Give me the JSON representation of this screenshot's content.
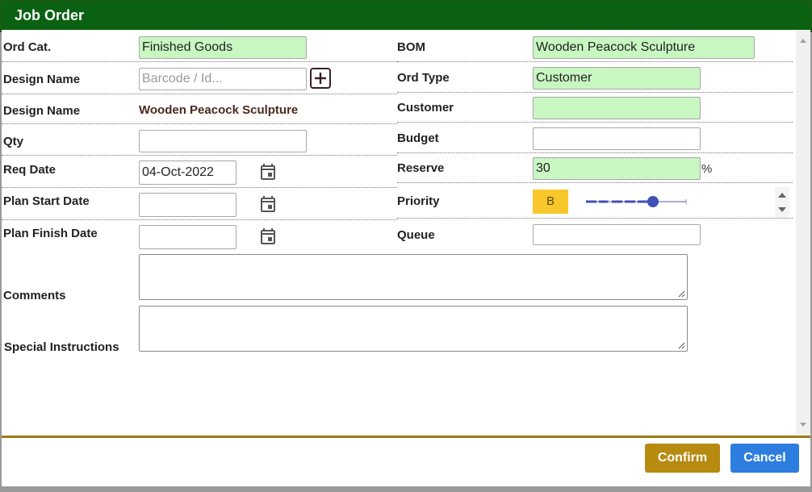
{
  "dialog": {
    "title": "Job Order"
  },
  "form": {
    "ord_cat": {
      "label": "Ord Cat.",
      "value": "Finished Goods"
    },
    "design_name_search": {
      "label": "Design Name",
      "placeholder": "Barcode / Id..."
    },
    "design_name_display": {
      "label": "Design Name",
      "value": "Wooden Peacock Sculpture"
    },
    "qty": {
      "label": "Qty",
      "value": ""
    },
    "req_date": {
      "label": "Req Date",
      "value": "04-Oct-2022"
    },
    "plan_start_date": {
      "label": "Plan Start Date",
      "value": ""
    },
    "plan_finish_date": {
      "label": "Plan Finish Date",
      "value": ""
    },
    "bom": {
      "label": "BOM",
      "value": "Wooden Peacock Sculpture"
    },
    "ord_type": {
      "label": "Ord Type",
      "value": "Customer"
    },
    "customer": {
      "label": "Customer",
      "value": ""
    },
    "budget": {
      "label": "Budget",
      "value": ""
    },
    "reserve": {
      "label": "Reserve",
      "value": "30",
      "unit": "%"
    },
    "priority": {
      "label": "Priority",
      "badge": "B",
      "level": 0.68
    },
    "queue": {
      "label": "Queue",
      "value": ""
    },
    "comments": {
      "label": "Comments",
      "value": ""
    },
    "special_instructions": {
      "label": "Special Instructions",
      "value": ""
    }
  },
  "footer": {
    "confirm_label": "Confirm",
    "cancel_label": "Cancel"
  },
  "colors": {
    "title_bar": "#0b6112",
    "field_highlight": "#c8f7c2",
    "priority_badge": "#f7c72b",
    "confirm": "#b78a10",
    "cancel": "#2d7ddf",
    "slider": "#3f51b5"
  }
}
